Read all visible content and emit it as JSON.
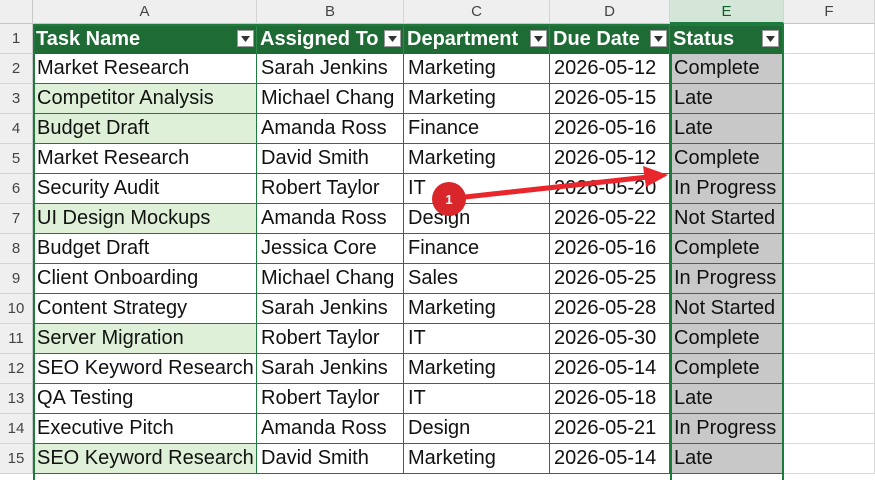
{
  "columns": [
    "A",
    "B",
    "C",
    "D",
    "E",
    "F"
  ],
  "headers": {
    "task_name": "Task Name",
    "assigned_to": "Assigned To",
    "department": "Department",
    "due_date": "Due Date",
    "status": "Status"
  },
  "row_numbers": [
    "1",
    "2",
    "3",
    "4",
    "5",
    "6",
    "7",
    "8",
    "9",
    "10",
    "11",
    "12",
    "13",
    "14",
    "15"
  ],
  "rows": [
    {
      "task": "Market Research",
      "assigned": "Sarah Jenkins",
      "dept": "Marketing",
      "due": "2026-05-12",
      "status": "Complete"
    },
    {
      "task": "Competitor Analysis",
      "assigned": "Michael Chang",
      "dept": "Marketing",
      "due": "2026-05-15",
      "status": "Late"
    },
    {
      "task": "Budget Draft",
      "assigned": "Amanda Ross",
      "dept": "Finance",
      "due": "2026-05-16",
      "status": "Late"
    },
    {
      "task": "Market Research",
      "assigned": "David Smith",
      "dept": "Marketing",
      "due": "2026-05-12",
      "status": "Complete"
    },
    {
      "task": "Security Audit",
      "assigned": "Robert Taylor",
      "dept": "IT",
      "due": "2026-05-20",
      "status": "In Progress"
    },
    {
      "task": "UI Design Mockups",
      "assigned": "Amanda Ross",
      "dept": "Design",
      "due": "2026-05-22",
      "status": "Not Started"
    },
    {
      "task": "Budget Draft",
      "assigned": "Jessica Core",
      "dept": "Finance",
      "due": "2026-05-16",
      "status": "Complete"
    },
    {
      "task": "Client Onboarding",
      "assigned": "Michael Chang",
      "dept": "Sales",
      "due": "2026-05-25",
      "status": "In Progress"
    },
    {
      "task": "Content Strategy",
      "assigned": "Sarah Jenkins",
      "dept": "Marketing",
      "due": "2026-05-28",
      "status": "Not Started"
    },
    {
      "task": "Server Migration",
      "assigned": "Robert Taylor",
      "dept": "IT",
      "due": "2026-05-30",
      "status": "Complete"
    },
    {
      "task": "SEO Keyword Research",
      "assigned": "Sarah Jenkins",
      "dept": "Marketing",
      "due": "2026-05-14",
      "status": "Complete"
    },
    {
      "task": "QA Testing",
      "assigned": "Robert Taylor",
      "dept": "IT",
      "due": "2026-05-18",
      "status": "Late"
    },
    {
      "task": "Executive Pitch",
      "assigned": "Amanda Ross",
      "dept": "Design",
      "due": "2026-05-21",
      "status": "In Progress"
    },
    {
      "task": "SEO Keyword Research",
      "assigned": "David Smith",
      "dept": "Marketing",
      "due": "2026-05-14",
      "status": "Late"
    }
  ],
  "duplicate_highlighted_rows": [
    1,
    3,
    4,
    7,
    11,
    15
  ],
  "selected_column": "E",
  "annotation": {
    "badge_label": "1",
    "color": "#e8262b"
  },
  "colors": {
    "table_header": "#1f6b36",
    "duplicate_fill": "#dff0d8",
    "status_fill": "#c8c8c8",
    "accent": "#1f7a3e"
  }
}
